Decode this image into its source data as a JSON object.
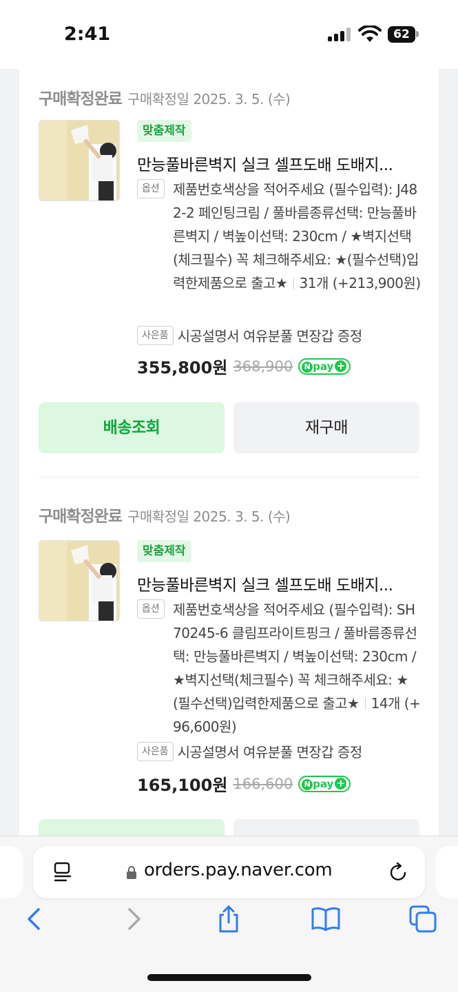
{
  "status_bar": {
    "time": "2:41",
    "battery": "62"
  },
  "orders": [
    {
      "status": "구매확정완료",
      "date": "구매확정일 2025. 3. 5. (수)",
      "tag": "맞춤제작",
      "product_name": "만능풀바른벽지 실크 셀프도배 도배지...",
      "option_label": "옵션",
      "option_text": "제품번호색상을 적어주세요 (필수입력): J482-2 페인팅크림 / 풀바름종류선택: 만능풀바른벽지 / 벽높이선택: 230cm / ★벽지선택(체크필수) 꼭 체크해주세요: ★(필수선택)입력한제품으로 출고★",
      "quantity": "31개 (+213,900원)",
      "gift_label": "사은품",
      "gift_text": "시공설명서 여유분풀 면장갑 증정",
      "price": "355,800원",
      "original_price": "368,900",
      "button_delivery": "배송조회",
      "button_reorder": "재구매"
    },
    {
      "status": "구매확정완료",
      "date": "구매확정일 2025. 3. 5. (수)",
      "tag": "맞춤제작",
      "product_name": "만능풀바른벽지 실크 셀프도배 도배지...",
      "option_label": "옵션",
      "option_text": "제품번호색상을 적어주세요 (필수입력): SH70245-6 클림프라이트핑크 / 풀바름종류선택: 만능풀바른벽지 / 벽높이선택: 230cm / ★벽지선택(체크필수) 꼭 체크해주세요: ★(필수선택)입력한제품으로 출고★",
      "quantity": "14개 (+96,600원)",
      "gift_label": "사은품",
      "gift_text": "시공설명서 여유분풀 면장갑 증정",
      "price": "165,100원",
      "original_price": "166,600"
    }
  ],
  "npay": {
    "text": "pay",
    "n": "N",
    "plus": "+"
  },
  "browser": {
    "url": "orders.pay.naver.com"
  },
  "icons": [
    "reader-icon",
    "lock-icon",
    "reload-icon",
    "back-icon",
    "forward-icon",
    "share-icon",
    "bookmarks-icon",
    "tabs-icon"
  ],
  "colors": {
    "green": "#1ec64a",
    "green_button_bg": "#dcf8e1",
    "tag_bg": "#e3f7e7"
  }
}
